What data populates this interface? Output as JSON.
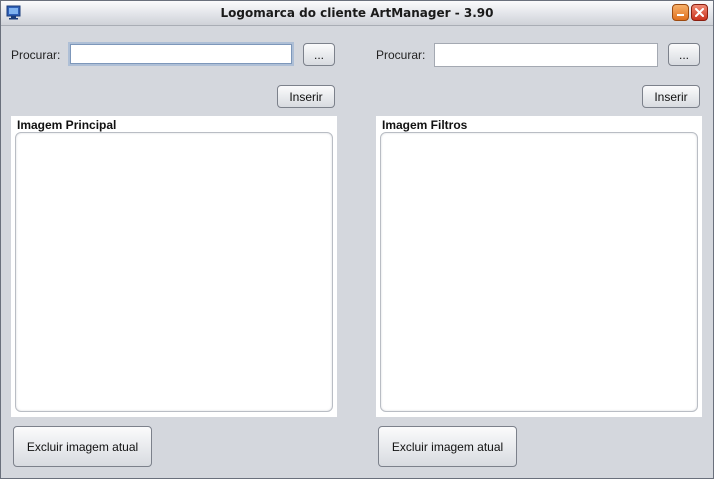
{
  "window": {
    "title": "Logomarca do cliente ArtManager - 3.90",
    "icons": [
      "app-icon",
      "minimize-icon",
      "close-icon"
    ]
  },
  "left": {
    "search_label": "Procurar:",
    "search_value": "",
    "browse_label": "...",
    "insert_label": "Inserir",
    "panel_title": "Imagem Principal",
    "delete_label": "Excluir imagem atual"
  },
  "right": {
    "search_label": "Procurar:",
    "search_value": "",
    "browse_label": "...",
    "insert_label": "Inserir",
    "panel_title": "Imagem Filtros",
    "delete_label": "Excluir imagem atual"
  },
  "colors": {
    "background": "#d4d7dd",
    "panel": "#ffffff",
    "close_button": "#c9321d",
    "minimize_button": "#e0701e"
  }
}
